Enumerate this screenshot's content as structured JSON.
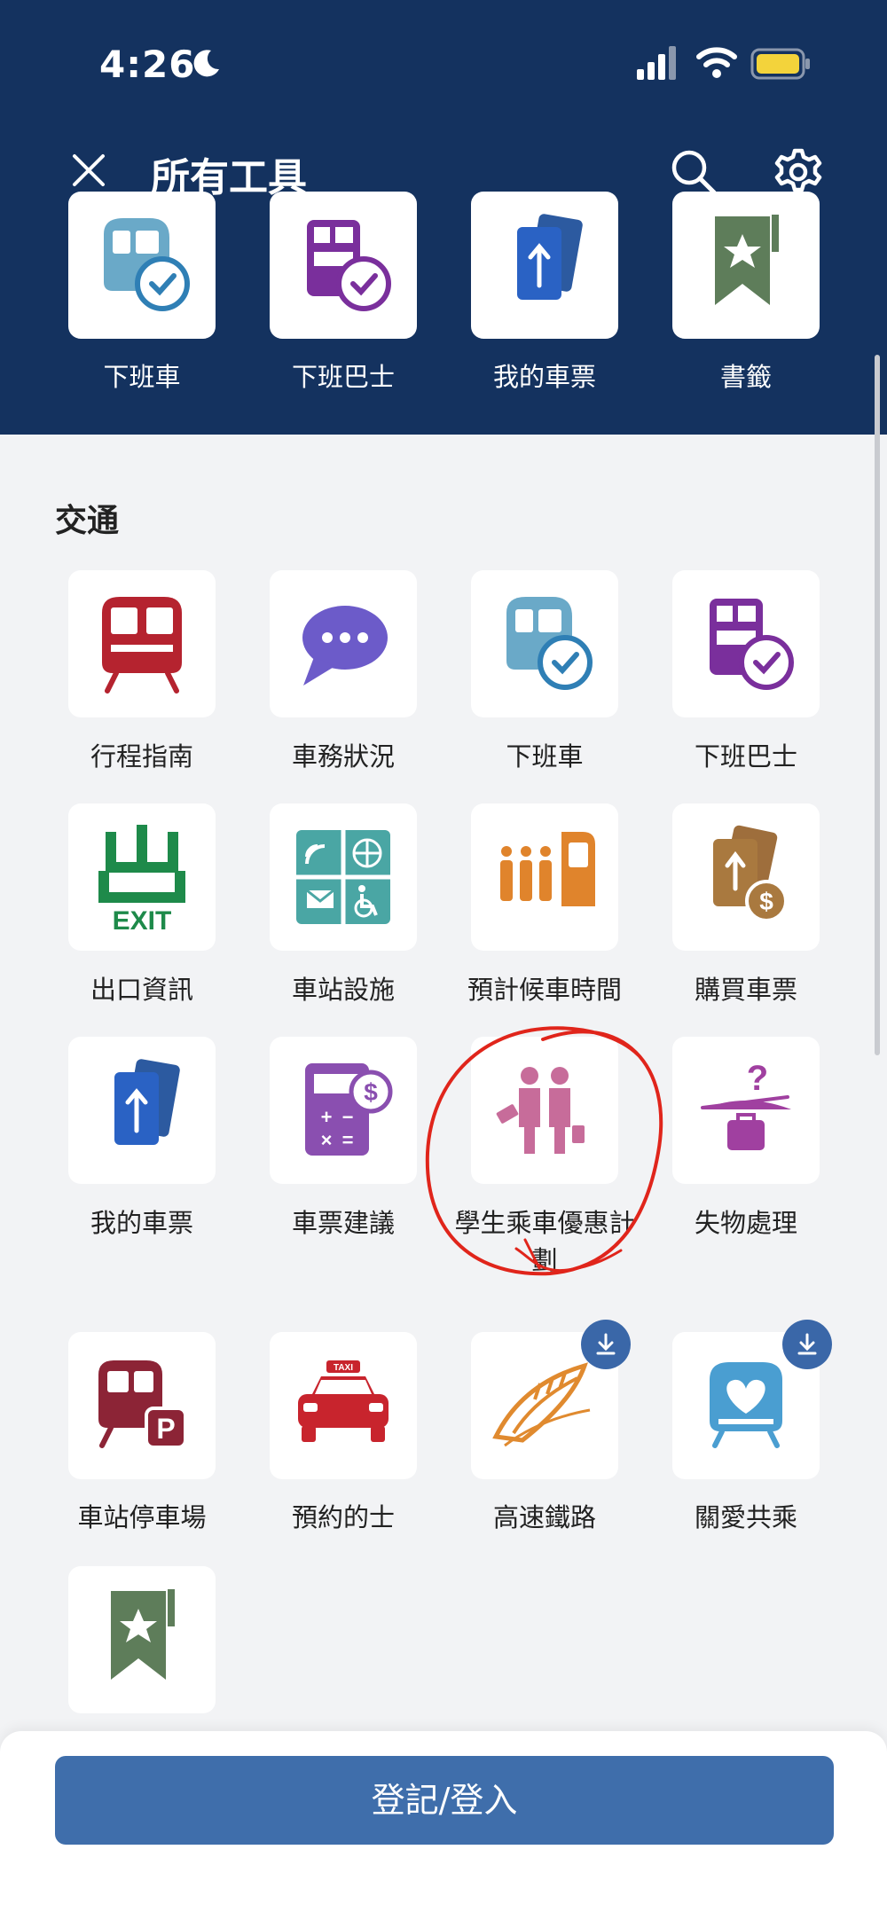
{
  "status_bar": {
    "time": "4:26"
  },
  "header": {
    "title": "所有工具"
  },
  "favorites": [
    {
      "label": "下班車",
      "icon": "train-clock-icon"
    },
    {
      "label": "下班巴士",
      "icon": "bus-clock-icon"
    },
    {
      "label": "我的車票",
      "icon": "ticket-icon"
    },
    {
      "label": "書籤",
      "icon": "bookmark-icon"
    }
  ],
  "section": {
    "title": "交通"
  },
  "tools": [
    {
      "label": "行程指南",
      "icon": "train-front-icon"
    },
    {
      "label": "車務狀況",
      "icon": "chat-bubble-icon"
    },
    {
      "label": "下班車",
      "icon": "train-clock-icon"
    },
    {
      "label": "下班巴士",
      "icon": "bus-clock-icon"
    },
    {
      "label": "出口資訊",
      "icon": "exit-sign-icon",
      "icon_text": "EXIT"
    },
    {
      "label": "車站設施",
      "icon": "station-facilities-icon"
    },
    {
      "label": "預計候車時間",
      "icon": "waiting-time-icon"
    },
    {
      "label": "購買車票",
      "icon": "buy-ticket-icon"
    },
    {
      "label": "我的車票",
      "icon": "ticket-icon"
    },
    {
      "label": "車票建議",
      "icon": "fare-calculator-icon"
    },
    {
      "label": "學生乘車優惠計劃",
      "icon": "students-icon"
    },
    {
      "label": "失物處理",
      "icon": "lost-property-icon"
    },
    {
      "label": "車站停車場",
      "icon": "station-parking-icon",
      "icon_text": "P"
    },
    {
      "label": "預約的士",
      "icon": "taxi-icon",
      "icon_text": "TAXI"
    },
    {
      "label": "高速鐵路",
      "icon": "high-speed-rail-icon",
      "download": true
    },
    {
      "label": "關愛共乘",
      "icon": "caring-ride-icon",
      "download": true
    },
    {
      "label": "",
      "icon": "bookmark-icon"
    }
  ],
  "login": {
    "label": "登記/登入"
  },
  "colors": {
    "header_bg": "#14325f",
    "page_bg": "#f2f3f5",
    "button_bg": "#3f6eab",
    "badge_bg": "#3a67a8",
    "annotation": "#e0251b"
  }
}
